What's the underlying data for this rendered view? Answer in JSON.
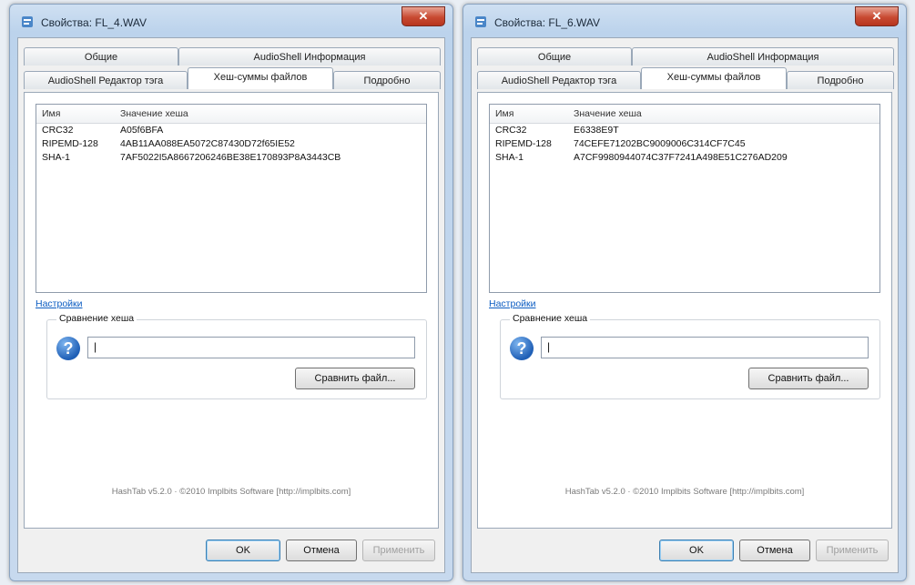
{
  "dialogs": [
    {
      "title": "Свойства: FL_4.WAV",
      "close": "✕",
      "tabs_row1": [
        "Общие",
        "AudioShell Информация"
      ],
      "tabs_row2": [
        "AudioShell Редактор тэга",
        "Хеш-суммы файлов",
        "Подробно"
      ],
      "columns": [
        "Имя",
        "Значение хеша"
      ],
      "rows": [
        {
          "name": "CRC32",
          "value": "A05f6BFA"
        },
        {
          "name": "RIPEMD-128",
          "value": "4AB11AA088EA5072C87430D72f65IE52"
        },
        {
          "name": "SHA-1",
          "value": "7AF5022I5A8667206246BE38E170893P8A3443CB"
        }
      ],
      "settings_link": "Настройки",
      "group_label": "Сравнение хеша",
      "input_value": "|",
      "compare_button": "Сравнить файл...",
      "footer": "HashTab v5.2.0 · ©2010 Implbits Software [http://implbits.com]",
      "ok": "OK",
      "cancel": "Отмена",
      "apply": "Применить"
    },
    {
      "title": "Свойства: FL_6.WAV",
      "close": "✕",
      "tabs_row1": [
        "Общие",
        "AudioShell Информация"
      ],
      "tabs_row2": [
        "AudioShell Редактор тэга",
        "Хеш-суммы файлов",
        "Подробно"
      ],
      "columns": [
        "Имя",
        "Значение хеша"
      ],
      "rows": [
        {
          "name": "CRC32",
          "value": "E6338E9T"
        },
        {
          "name": "RIPEMD-128",
          "value": "74CEFE71202BC9009006C314CF7C45"
        },
        {
          "name": "SHA-1",
          "value": "A7CF9980944074C37F7241A498E51C276AD209"
        }
      ],
      "settings_link": "Настройки",
      "group_label": "Сравнение хеша",
      "input_value": "|",
      "compare_button": "Сравнить файл...",
      "footer": "HashTab v5.2.0 · ©2010 Implbits Software [http://implbits.com]",
      "ok": "OK",
      "cancel": "Отмена",
      "apply": "Применить"
    }
  ]
}
